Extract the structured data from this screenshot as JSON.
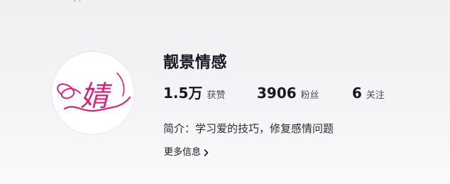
{
  "profile": {
    "name": "靓景情感",
    "avatar_glyph": "婧",
    "avatar_icon": "calligraphy-logo-icon",
    "bio": "简介：学习爱的技巧，修复感情问题"
  },
  "stats": {
    "likes": {
      "value": "1.5万",
      "label": "获赞"
    },
    "fans": {
      "value": "3906",
      "label": "粉丝"
    },
    "following": {
      "value": "6",
      "label": "关注"
    }
  },
  "more_info": {
    "label": "更多信息",
    "icon": "chevron-right-icon"
  },
  "colors": {
    "text": "#161823",
    "secondary_text": "#4b4c55",
    "avatar_accent": "#d4257e",
    "background_top": "#f0f0f2",
    "background_bottom": "#fafafb"
  }
}
